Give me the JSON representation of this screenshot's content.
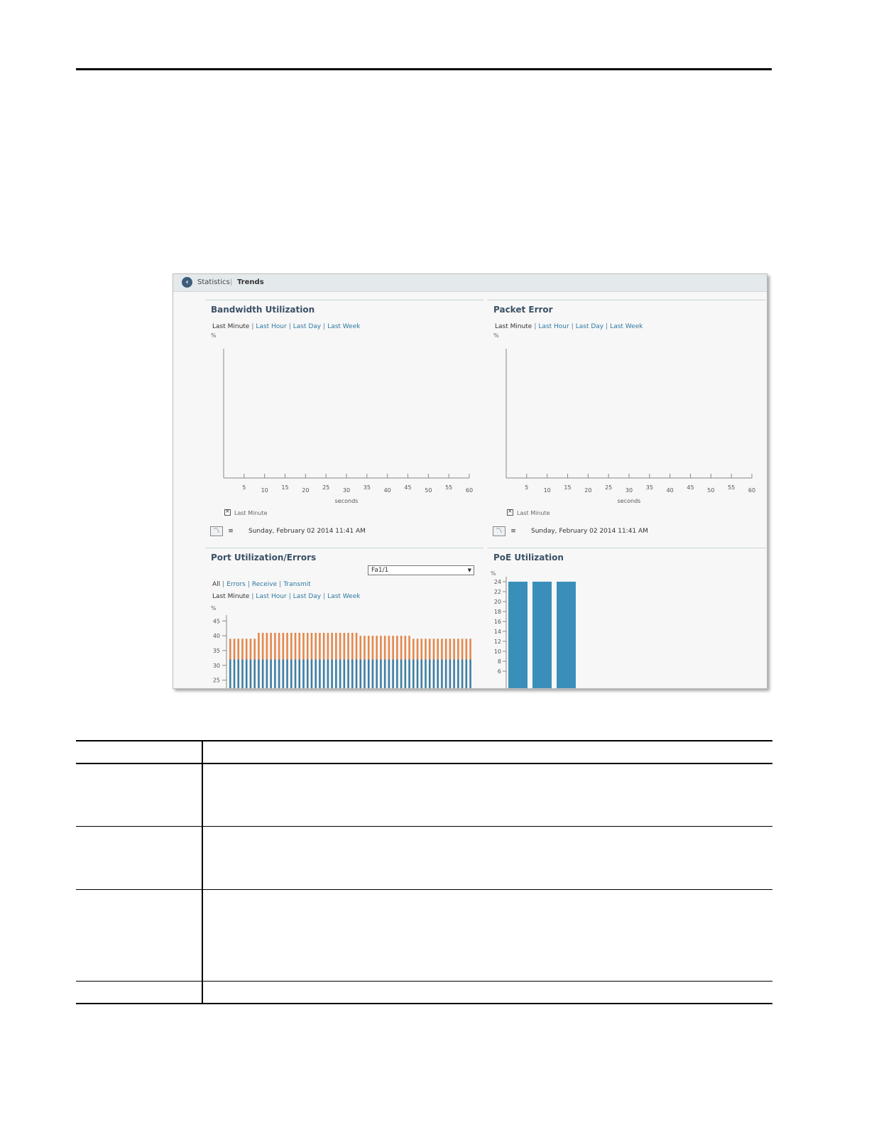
{
  "breadcrumb": {
    "back_icon": "chevron-left-icon",
    "parent": "Statistics",
    "separator": "|",
    "current": "Trends"
  },
  "time_ranges": [
    "Last Minute",
    "Last Hour",
    "Last Day",
    "Last Week"
  ],
  "port_filters": [
    "All",
    "Errors",
    "Receive",
    "Transmit"
  ],
  "bandwidth": {
    "title": "Bandwidth Utilization",
    "unit": "%",
    "xlabel": "seconds",
    "legend": "Last Minute",
    "timestamp": "Sunday, February 02 2014 11:41 AM"
  },
  "packet_error": {
    "title": "Packet Error",
    "unit": "%",
    "xlabel": "seconds",
    "legend": "Last Minute",
    "timestamp": "Sunday, February 02 2014 11:41 AM"
  },
  "port_util": {
    "title": "Port Utilization/Errors",
    "port_select": "Fa1/1",
    "unit": "%"
  },
  "poe": {
    "title": "PoE Utilization",
    "unit": "%"
  },
  "chart_data": [
    {
      "type": "line",
      "x_ticks": [
        5,
        10,
        15,
        20,
        25,
        30,
        35,
        40,
        45,
        50,
        55,
        60
      ],
      "xlabel": "seconds",
      "ylabel": "%",
      "series": [
        {
          "name": "Last Minute",
          "values": []
        }
      ]
    },
    {
      "type": "line",
      "x_ticks": [
        5,
        10,
        15,
        20,
        25,
        30,
        35,
        40,
        45,
        50,
        55,
        60
      ],
      "xlabel": "seconds",
      "ylabel": "%",
      "series": [
        {
          "name": "Last Minute",
          "values": []
        }
      ]
    },
    {
      "type": "bar",
      "stacked": true,
      "ylabel": "%",
      "y_ticks": [
        25,
        30,
        35,
        40,
        45
      ],
      "ylim": [
        23,
        47
      ],
      "bar_count": 60,
      "colors": {
        "base": "#3e7ea3",
        "top": "#e5874b"
      },
      "series": [
        {
          "values": [
            32,
            32,
            32,
            32,
            32,
            32,
            32,
            32,
            32,
            32,
            32,
            32,
            32,
            32,
            32,
            32,
            32,
            32,
            32,
            32,
            32,
            32,
            32,
            32,
            32,
            32,
            32,
            32,
            32,
            32,
            32,
            32,
            32,
            32,
            32,
            32,
            32,
            32,
            32,
            32,
            32,
            32,
            32,
            32,
            32,
            32,
            32,
            32,
            32,
            32,
            32,
            32,
            32,
            32,
            32,
            32,
            32,
            32,
            32,
            32
          ]
        },
        {
          "values": [
            39,
            39,
            39,
            39,
            39,
            39,
            39,
            41,
            41,
            41,
            41,
            41,
            41,
            41,
            41,
            41,
            41,
            41,
            41,
            41,
            41,
            41,
            41,
            41,
            41,
            41,
            41,
            41,
            41,
            41,
            41,
            41,
            40,
            40,
            40,
            40,
            40,
            40,
            40,
            40,
            40,
            40,
            40,
            40,
            40,
            39,
            39,
            39,
            39,
            39,
            39,
            39,
            39,
            39,
            39,
            39,
            39,
            39,
            39,
            39
          ]
        }
      ]
    },
    {
      "type": "bar",
      "ylabel": "%",
      "y_ticks": [
        6,
        8,
        10,
        12,
        14,
        16,
        18,
        20,
        22,
        24
      ],
      "ylim": [
        5,
        25
      ],
      "colors": {
        "bar": "#3a8fba"
      },
      "values": [
        24,
        24,
        24
      ]
    }
  ]
}
